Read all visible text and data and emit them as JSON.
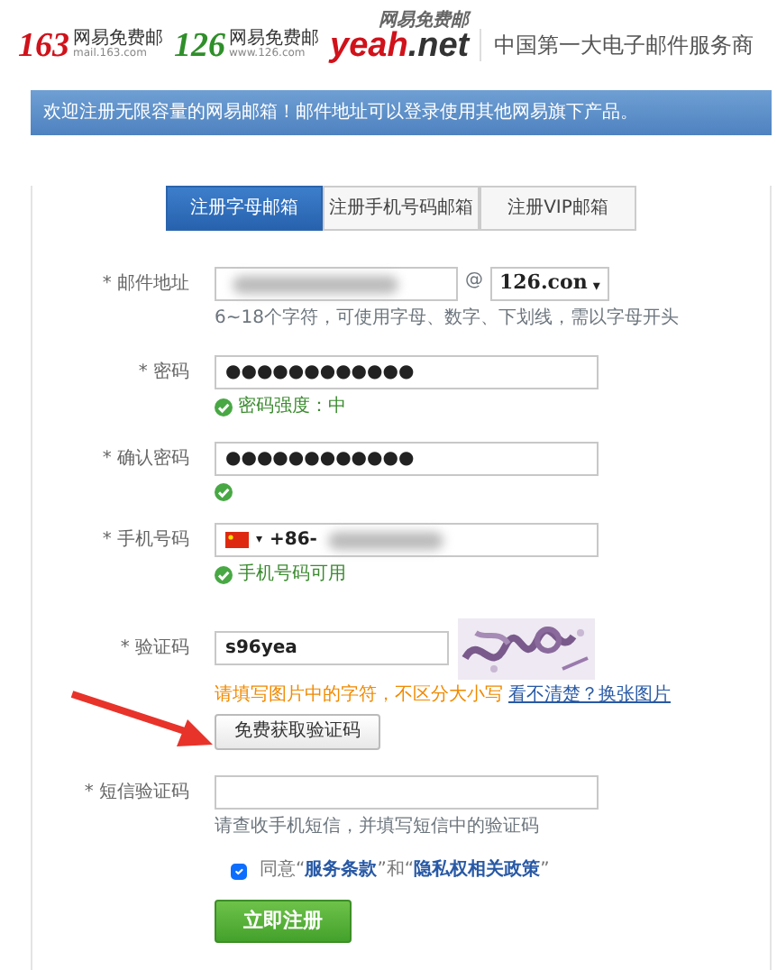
{
  "header": {
    "logos": [
      {
        "kind": "numeric",
        "number": "163",
        "subtitle": "网易免费邮",
        "domain": "mail.163.com",
        "color": "#d0121b"
      },
      {
        "kind": "numeric",
        "number": "126",
        "subtitle": "网易免费邮",
        "domain": "www.126.com",
        "color": "#2f8f2a"
      },
      {
        "kind": "word",
        "number": "yeah",
        "suffix": ".net",
        "subtitle": "网易免费邮",
        "color": "#d0121b"
      }
    ],
    "slogan": "中国第一大电子邮件服务商"
  },
  "banner": "欢迎注册无限容量的网易邮箱！邮件地址可以登录使用其他网易旗下产品。",
  "tabs": [
    {
      "label": "注册字母邮箱",
      "selected": true
    },
    {
      "label": "注册手机号码邮箱",
      "selected": false
    },
    {
      "label": "注册VIP邮箱",
      "selected": false
    }
  ],
  "fields": [
    {
      "kind": "email",
      "marker": "*",
      "label": "邮件地址",
      "at": "@",
      "domain": "126.con",
      "caret": "▾",
      "hint": "6~18个字符，可使用字母、数字、下划线，需以字母开头"
    },
    {
      "kind": "password",
      "marker": "*",
      "label": "密码",
      "value": "●●●●●●●●●●●●",
      "valid": true,
      "status": "密码强度：中"
    },
    {
      "kind": "password",
      "marker": "*",
      "label": "确认密码",
      "value": "●●●●●●●●●●●●",
      "valid": true
    },
    {
      "kind": "phone",
      "marker": "*",
      "label": "手机号码",
      "caret": "▾",
      "value": "+86-",
      "valid": true,
      "status": "手机号码可用"
    },
    {
      "kind": "captcha",
      "marker": "*",
      "label": "验证码",
      "value": "s96yea",
      "warning": "请填写图片中的字符，不区分大小写",
      "refresh": "看不清楚？换张图片",
      "button": "免费获取验证码"
    },
    {
      "kind": "sms",
      "marker": "*",
      "label": "短信验证码",
      "hint": "请查收手机短信，并填写短信中的验证码"
    }
  ],
  "agree": {
    "checked": true,
    "prefix": "同意“",
    "link1": "服务条款",
    "middle": "”和“",
    "link2": "隐私权相关政策",
    "suffix": "”"
  },
  "submit": "立即注册"
}
